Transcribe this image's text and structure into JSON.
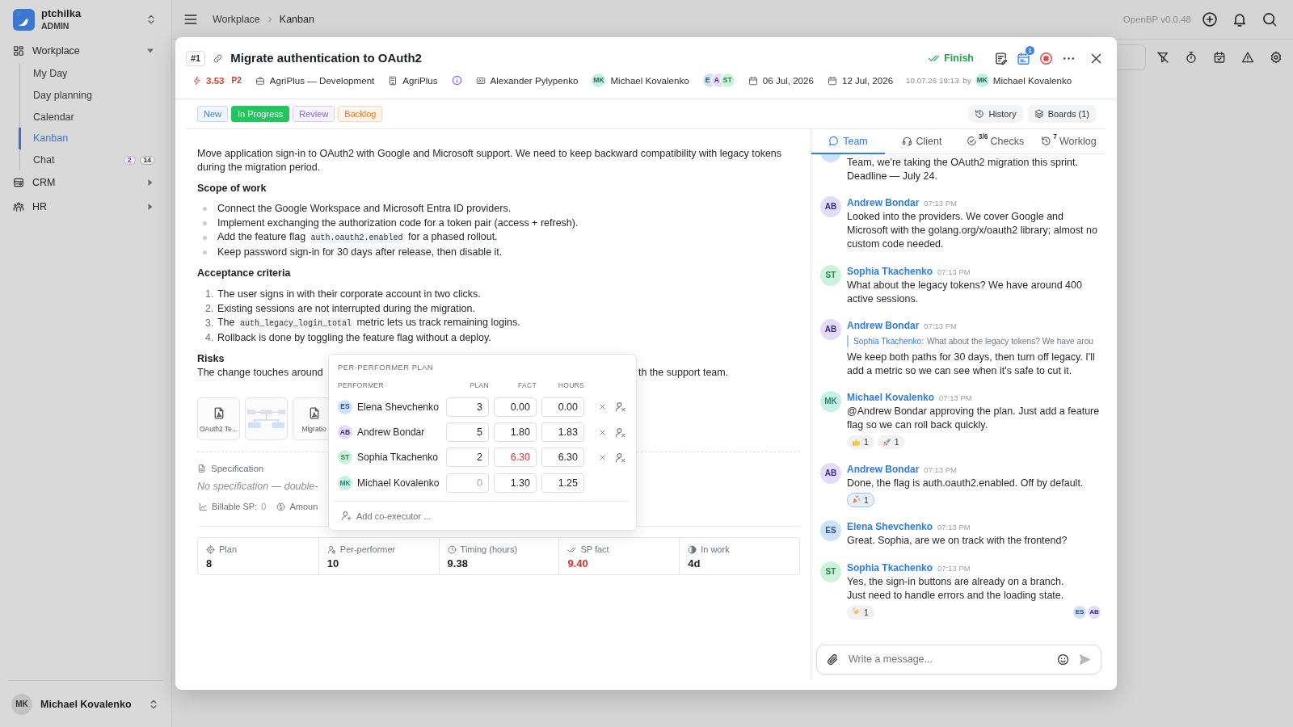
{
  "sidebar": {
    "workspace": {
      "name": "ptchilka",
      "role": "ADMIN"
    },
    "nav": [
      {
        "label": "Workplace",
        "expanded": true,
        "children": [
          {
            "label": "My Day",
            "selected": false
          },
          {
            "label": "Day planning",
            "selected": false
          },
          {
            "label": "Calendar",
            "selected": false
          },
          {
            "label": "Kanban",
            "selected": true
          },
          {
            "label": "Chat",
            "selected": false,
            "badges": [
              {
                "text": "2",
                "color": "#6d3fd1"
              },
              {
                "text": "14",
                "color": "#3f3f46"
              }
            ]
          }
        ]
      },
      {
        "label": "CRM",
        "expanded": false
      },
      {
        "label": "HR",
        "expanded": false
      }
    ],
    "user": {
      "initials": "MK",
      "name": "Michael Kovalenko"
    }
  },
  "top_bar": {
    "breadcrumb": [
      "Workplace",
      "Kanban"
    ],
    "version": "OpenBP v0.0.48"
  },
  "task": {
    "number": "#1",
    "title": "Migrate authentication to OAuth2",
    "finish_label": "Finish",
    "calendar_badge": "1",
    "meta": {
      "estimate": "3.53",
      "priority": "P2",
      "project": "AgriPlus — Development",
      "client": "AgriPlus",
      "owner": "Alexander Pylypenko",
      "assignee": {
        "initials": "MK",
        "name": "Michael Kovalenko"
      },
      "watchers": [
        {
          "initials": "E",
          "color": "#cfe2fb"
        },
        {
          "initials": "A",
          "color": "#e3dcfb"
        },
        {
          "initials": "ST",
          "color": "#cdf2dc"
        }
      ],
      "start_date": "06 Jul, 2026",
      "due_date": "12 Jul, 2026",
      "updated_at": "10.07.26 19:13",
      "updated_by_label": "by",
      "updated_by": {
        "initials": "MK",
        "name": "Michael Kovalenko"
      }
    },
    "statuses": [
      {
        "label": "New",
        "color": "#3b82f6",
        "selected": false
      },
      {
        "label": "In Progress",
        "color": "#22c55e",
        "selected": true
      },
      {
        "label": "Review",
        "color": "#8b5cf6",
        "selected": false
      },
      {
        "label": "Backlog",
        "color": "#f97316",
        "selected": false
      }
    ],
    "history_label": "History",
    "boards_label": "Boards (1)",
    "description": [
      {
        "kind": "paragraph",
        "text": "Move application sign-in to OAuth2 with Google and Microsoft support. We need to keep backward compatibility with legacy tokens during the migration period."
      },
      {
        "kind": "heading",
        "text": "Scope of work"
      },
      {
        "kind": "bullets",
        "items": [
          {
            "parts": [
              {
                "kind": "text",
                "text": "Connect the Google Workspace and Microsoft Entra ID providers."
              }
            ]
          },
          {
            "parts": [
              {
                "kind": "text",
                "text": "Implement exchanging the authorization code for a token pair (access + refresh)."
              }
            ]
          },
          {
            "parts": [
              {
                "kind": "text",
                "text": "Add the feature flag "
              },
              {
                "kind": "code",
                "text": "auth.oauth2.enabled"
              },
              {
                "kind": "text",
                "text": " for a phased rollout."
              }
            ]
          },
          {
            "parts": [
              {
                "kind": "text",
                "text": "Keep password sign-in for 30 days after release, then disable it."
              }
            ]
          }
        ]
      },
      {
        "kind": "heading",
        "text": "Acceptance criteria"
      },
      {
        "kind": "numbered",
        "items": [
          {
            "number": "1.",
            "parts": [
              {
                "kind": "text",
                "text": "The user signs in with their corporate account in two clicks."
              }
            ]
          },
          {
            "number": "2.",
            "parts": [
              {
                "kind": "text",
                "text": "Existing sessions are not interrupted during the migration."
              }
            ]
          },
          {
            "number": "3.",
            "parts": [
              {
                "kind": "text",
                "text": "The "
              },
              {
                "kind": "code",
                "text": "auth_legacy_login_total"
              },
              {
                "kind": "text",
                "text": " metric lets us track remaining logins."
              }
            ]
          },
          {
            "number": "4.",
            "parts": [
              {
                "kind": "text",
                "text": "Rollback is done by toggling the feature flag without a deploy."
              }
            ]
          }
        ]
      },
      {
        "kind": "heading",
        "text": "Risks"
      },
      {
        "kind": "fragments",
        "start": "The change touches around",
        "end": "th the support team."
      }
    ],
    "attachments": [
      {
        "kind": "pdf",
        "name": "OAuth2 Te..."
      },
      {
        "kind": "image"
      },
      {
        "kind": "pdf",
        "name": "Migratio"
      }
    ],
    "specification": {
      "label": "Specification",
      "text": "No specification — double-"
    },
    "billing": {
      "billable_label": "Billable SP:",
      "billable_value": "0",
      "amount_label": "Amoun"
    },
    "stats": [
      {
        "label": "Plan",
        "value": "8",
        "alert": false
      },
      {
        "label": "Per-performer",
        "value": "10",
        "alert": false
      },
      {
        "label": "Timing (hours)",
        "value": "9.38",
        "alert": false
      },
      {
        "label": "SP fact",
        "value": "9.40",
        "alert": true
      },
      {
        "label": "In work",
        "value": "4d",
        "alert": false
      }
    ],
    "plan_popup": {
      "title": "PER-PERFORMER PLAN",
      "columns": [
        "PERFORMER",
        "PLAN",
        "FACT",
        "HOURS"
      ],
      "rows": [
        {
          "initials": "ES",
          "color": "#cfe2fb",
          "name": "Elena Shevchenko",
          "plan": "3",
          "fact": "0.00",
          "fact_over": false,
          "hours": "0.00",
          "removable": true
        },
        {
          "initials": "AB",
          "color": "#e3dcfb",
          "name": "Andrew Bondar",
          "plan": "5",
          "fact": "1.80",
          "fact_over": false,
          "hours": "1.83",
          "removable": true
        },
        {
          "initials": "ST",
          "color": "#cdf2dc",
          "name": "Sophia Tkachenko",
          "plan": "2",
          "fact": "6.30",
          "fact_over": true,
          "hours": "6.30",
          "removable": true
        },
        {
          "initials": "MK",
          "color": "#c6f1e7",
          "name": "Michael Kovalenko",
          "plan_placeholder": "0",
          "fact": "1.30",
          "fact_over": false,
          "hours": "1.25",
          "removable": false
        }
      ],
      "placeholder": "Add co-executor ..."
    },
    "chat": {
      "tabs": [
        {
          "label": "Team",
          "selected": true
        },
        {
          "label": "Client",
          "selected": false
        },
        {
          "label": "Checks",
          "badge": "3/6",
          "selected": false
        },
        {
          "label": "Worklog",
          "badge": "7",
          "selected": false
        }
      ],
      "messages": [
        {
          "color": "#cfe2fb",
          "text": "Team, we're taking the OAuth2 migration this sprint. Deadline — July 24."
        },
        {
          "initials": "AB",
          "color": "#e3dcfb",
          "author": "Andrew Bondar",
          "time": "07:13 PM",
          "text": "Looked into the providers. We cover Google and Microsoft with the golang.org/x/oauth2 library; almost no custom code needed."
        },
        {
          "initials": "ST",
          "color": "#cdf2dc",
          "author": "Sophia Tkachenko",
          "time": "07:13 PM",
          "text": "What about the legacy tokens? We have around 400 active sessions."
        },
        {
          "initials": "AB",
          "color": "#e3dcfb",
          "author": "Andrew Bondar",
          "time": "07:13 PM",
          "reply": {
            "author": "Sophia Tkachenko:",
            "text": "What about the legacy tokens? We have arou"
          },
          "text": "We keep both paths for 30 days, then turn off legacy. I'll add a metric so we can see when it's safe to cut it."
        },
        {
          "initials": "MK",
          "color": "#c6f1e7",
          "author": "Michael Kovalenko",
          "time": "07:13 PM",
          "text": "@Andrew Bondar approving the plan. Just add a feature flag so we can roll back quickly.",
          "reactions": [
            {
              "kind": "thumbs_up",
              "count": "1",
              "mine": false
            },
            {
              "kind": "rocket",
              "count": "1",
              "mine": false
            }
          ]
        },
        {
          "initials": "AB",
          "color": "#e3dcfb",
          "author": "Andrew Bondar",
          "time": "07:13 PM",
          "text": "Done, the flag is auth.oauth2.enabled. Off by default.",
          "reactions": [
            {
              "kind": "party",
              "count": "1",
              "mine": true
            }
          ]
        },
        {
          "initials": "ES",
          "color": "#cfe2fb",
          "author": "Elena Shevchenko",
          "time": "07:13 PM",
          "text": "Great. Sophia, are we on track with the frontend?"
        },
        {
          "initials": "ST",
          "color": "#cdf2dc",
          "author": "Sophia Tkachenko",
          "time": "07:13 PM",
          "text": "Yes, the sign-in buttons are already on a branch.\nJust need to handle errors and the loading state.",
          "reactions": [
            {
              "kind": "clap",
              "count": "1",
              "mine": false
            }
          ],
          "seen_by": [
            {
              "initials": "ES",
              "color": "#cfe2fb"
            },
            {
              "initials": "AB",
              "color": "#e3dcfb"
            }
          ]
        }
      ],
      "composer": {
        "placeholder": "Write a message..."
      }
    }
  }
}
